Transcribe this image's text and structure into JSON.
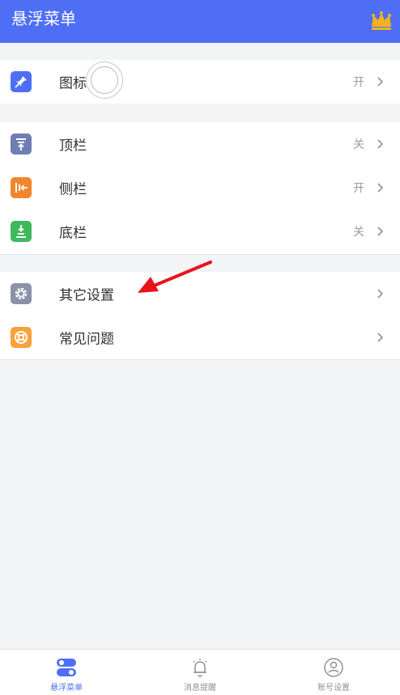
{
  "header": {
    "title": "悬浮菜单",
    "crown_icon": "crown-icon",
    "crown_color": "#f5b21c"
  },
  "groups": [
    {
      "items": [
        {
          "label": "图标",
          "status": "开",
          "icon": "pin-icon",
          "color": "#4f6ef6"
        }
      ]
    },
    {
      "items": [
        {
          "label": "顶栏",
          "status": "关",
          "icon": "top-bar-icon",
          "color": "#6f7fb4"
        },
        {
          "label": "侧栏",
          "status": "开",
          "icon": "side-bar-icon",
          "color": "#f2862c"
        },
        {
          "label": "底栏",
          "status": "关",
          "icon": "bottom-bar-icon",
          "color": "#3fb85e"
        }
      ]
    },
    {
      "items": [
        {
          "label": "其它设置",
          "status": "",
          "icon": "gear-icon",
          "color": "#8a92a8"
        },
        {
          "label": "常见问题",
          "status": "",
          "icon": "lifebuoy-icon",
          "color": "#f7a23a"
        }
      ]
    }
  ],
  "tabbar": {
    "tabs": [
      {
        "label": "悬浮菜单",
        "icon": "toggle-icon",
        "active": true
      },
      {
        "label": "消息提醒",
        "icon": "bell-icon",
        "active": false
      },
      {
        "label": "账号设置",
        "icon": "user-icon",
        "active": false
      }
    ]
  },
  "colors": {
    "accent": "#4f6ef6",
    "background": "#f3f4f6",
    "arrow": "#e8141b"
  }
}
